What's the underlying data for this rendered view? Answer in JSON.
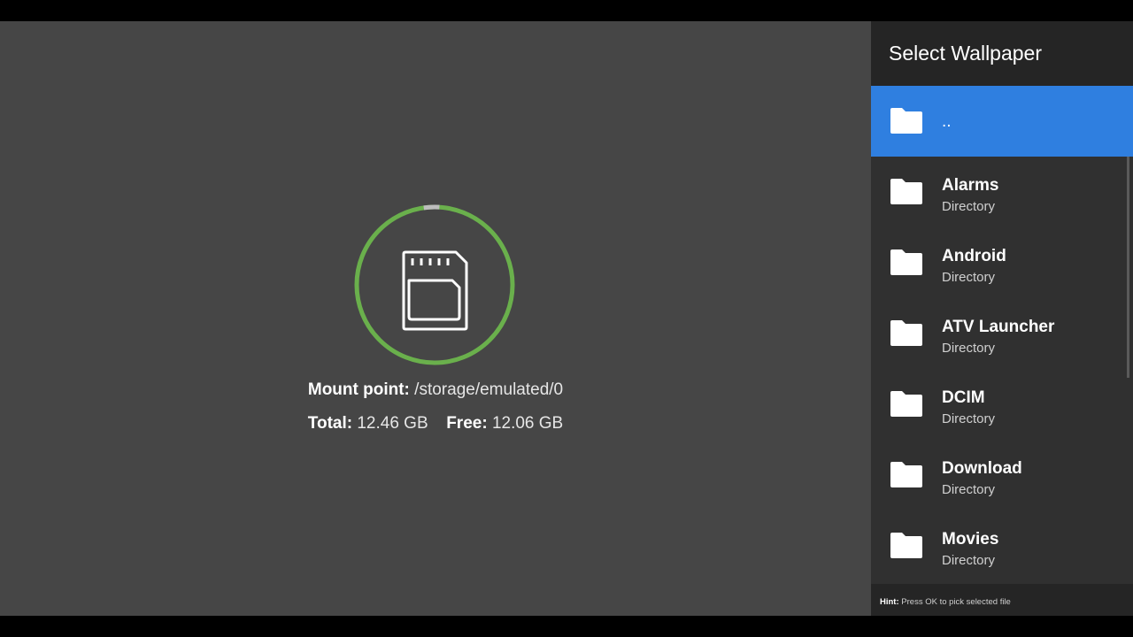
{
  "storage": {
    "icon": "sd-card-icon",
    "usage_fraction_used": 0.032,
    "ring_color": "#6ab04c",
    "ring_used_color": "#bdbdbd",
    "mount_label": "Mount point:",
    "mount_value": "/storage/emulated/0",
    "total_label": "Total:",
    "total_value": "12.46 GB",
    "free_label": "Free:",
    "free_value": "12.06 GB"
  },
  "panel": {
    "title": "Select Wallpaper",
    "accent": "#2f7fe0",
    "items": [
      {
        "name": "..",
        "type": "",
        "icon": "folder-icon",
        "selected": true
      },
      {
        "name": "Alarms",
        "type": "Directory",
        "icon": "folder-icon"
      },
      {
        "name": "Android",
        "type": "Directory",
        "icon": "folder-icon"
      },
      {
        "name": "ATV Launcher",
        "type": "Directory",
        "icon": "folder-icon"
      },
      {
        "name": "DCIM",
        "type": "Directory",
        "icon": "folder-icon"
      },
      {
        "name": "Download",
        "type": "Directory",
        "icon": "folder-icon"
      },
      {
        "name": "Movies",
        "type": "Directory",
        "icon": "folder-icon"
      }
    ],
    "hint_label": "Hint:",
    "hint_text": "Press OK to pick selected file"
  }
}
